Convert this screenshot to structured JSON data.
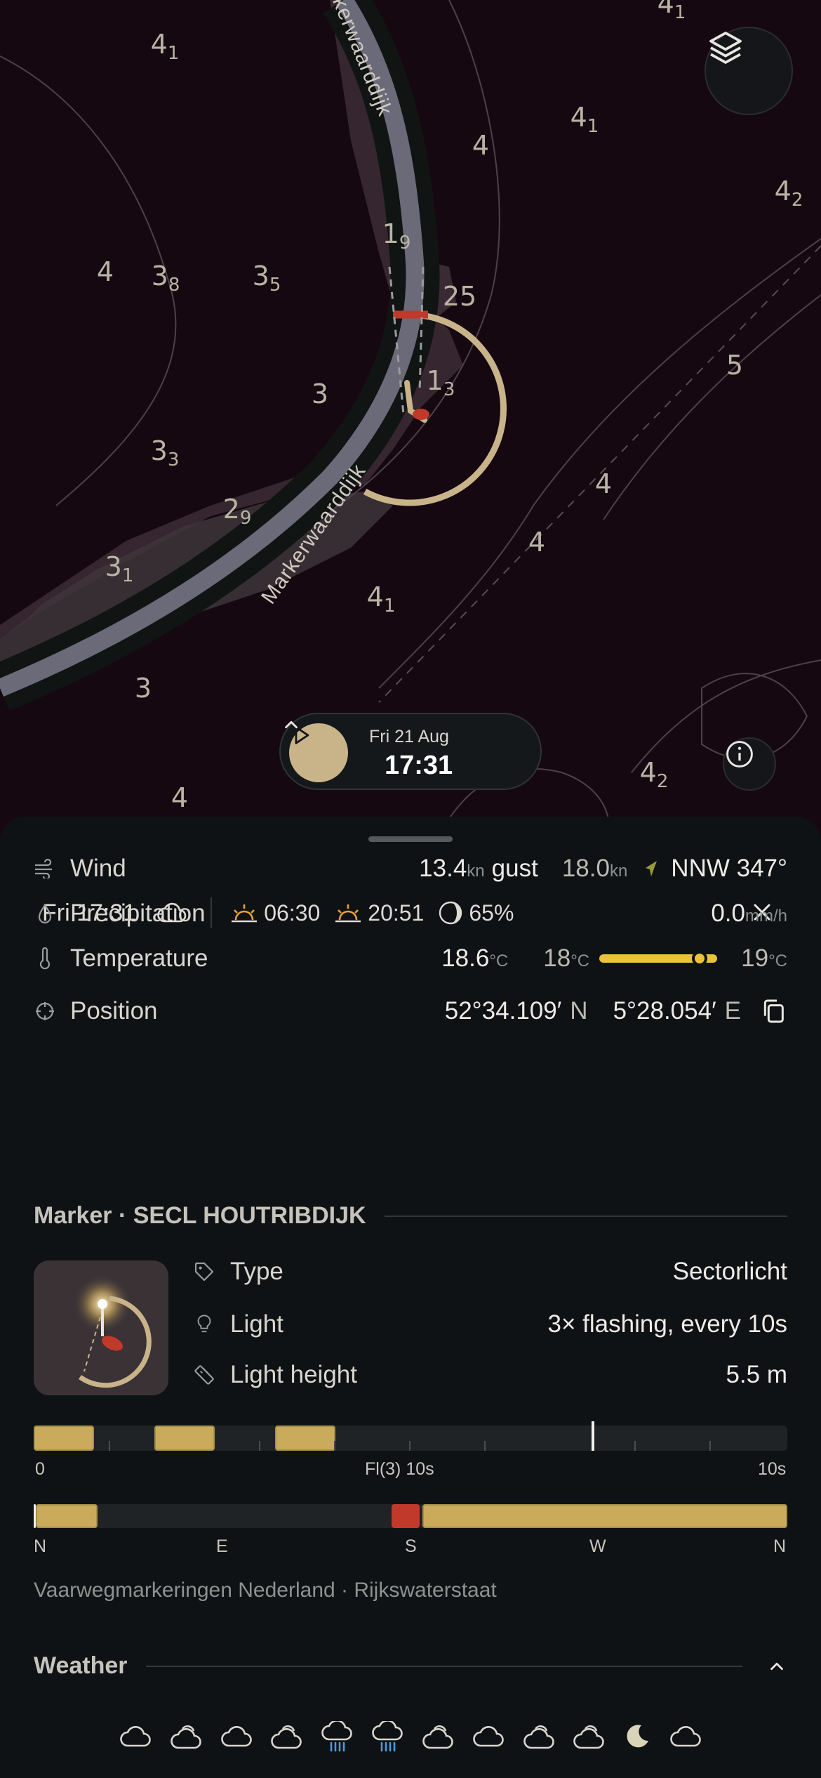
{
  "map": {
    "road_labels": [
      "kerwaarddijk",
      "Markerwaarddijk"
    ],
    "depth_soundings": [
      {
        "main": "4",
        "sub": "1"
      },
      {
        "main": "4",
        "sub": "1"
      },
      {
        "main": "4",
        "sub": "1"
      },
      {
        "main": "3",
        "sub": "8"
      },
      {
        "main": "3",
        "sub": "5"
      },
      {
        "main": "1",
        "sub": "9"
      },
      {
        "main": "1",
        "sub": "3"
      },
      {
        "main": "3",
        "sub": "3"
      },
      {
        "main": "2",
        "sub": "9"
      },
      {
        "main": "3",
        "sub": "1"
      },
      {
        "main": "4",
        "sub": "1"
      },
      {
        "main": "4",
        "sub": "2"
      },
      {
        "main": "4",
        "sub": "2"
      },
      {
        "main": "4",
        "sub": ""
      },
      {
        "main": "4",
        "sub": ""
      },
      {
        "main": "3",
        "sub": ""
      },
      {
        "main": "3",
        "sub": ""
      },
      {
        "main": "5",
        "sub": ""
      },
      {
        "main": "4",
        "sub": ""
      },
      {
        "main": "4",
        "sub": ""
      },
      {
        "main": "4",
        "sub": ""
      },
      {
        "main": "25",
        "sub": ""
      }
    ]
  },
  "controls": {
    "layers_icon": "layers-icon",
    "info_icon": "info-icon"
  },
  "timebar": {
    "date": "Fri 21 Aug",
    "time": "17:31"
  },
  "summary": {
    "day_time": "Fri 17:31",
    "sunrise": "06:30",
    "sunset": "20:51",
    "moon": "65%"
  },
  "conditions": {
    "wind": {
      "label": "Wind",
      "speed": "13.4",
      "speed_unit": "kn",
      "gust_label": "gust",
      "gust": "18.0",
      "gust_unit": "kn",
      "direction": "NNW 347°"
    },
    "precipitation": {
      "label": "Precipitation",
      "value": "0.0",
      "unit": "mm/h"
    },
    "temperature": {
      "label": "Temperature",
      "value": "18.6",
      "unit": "°C",
      "min": "18",
      "min_unit": "°C",
      "max": "19",
      "max_unit": "°C",
      "level": 0.85
    },
    "position": {
      "label": "Position",
      "lat": "52°34.109′",
      "lat_hemi": "N",
      "lon": "5°28.054′",
      "lon_hemi": "E"
    }
  },
  "marker": {
    "heading": "Marker · SECL HOUTRIBDIJK",
    "type_label": "Type",
    "type_value": "Sectorlicht",
    "light_label": "Light",
    "light_value": "3× flashing, every 10s",
    "height_label": "Light height",
    "height_value": "5.5 m",
    "sequence": {
      "start": "0",
      "middle": "Fl(3) 10s",
      "end": "10s",
      "flashes": [
        [
          0,
          0.08
        ],
        [
          0.16,
          0.24
        ],
        [
          0.32,
          0.4
        ]
      ],
      "cursor": 0.74
    },
    "sectors": {
      "labels": [
        "N",
        "E",
        "S",
        "W",
        "N"
      ],
      "colors": {
        "white": "#f0eee8",
        "yellow": "#c9ab5b",
        "red": "#c0392b"
      }
    },
    "source": "Vaarwegmarkeringen Nederland · Rijkswaterstaat"
  },
  "weather": {
    "heading": "Weather",
    "icons": [
      "cloud-icon",
      "cloud-sun-icon",
      "cloud-icon",
      "cloud-sun-icon",
      "rain-icon",
      "rain-icon",
      "cloud-sun-icon",
      "cloud-icon",
      "cloud-sun-icon",
      "cloud-sun-icon",
      "moon-icon",
      "cloud-icon"
    ]
  }
}
